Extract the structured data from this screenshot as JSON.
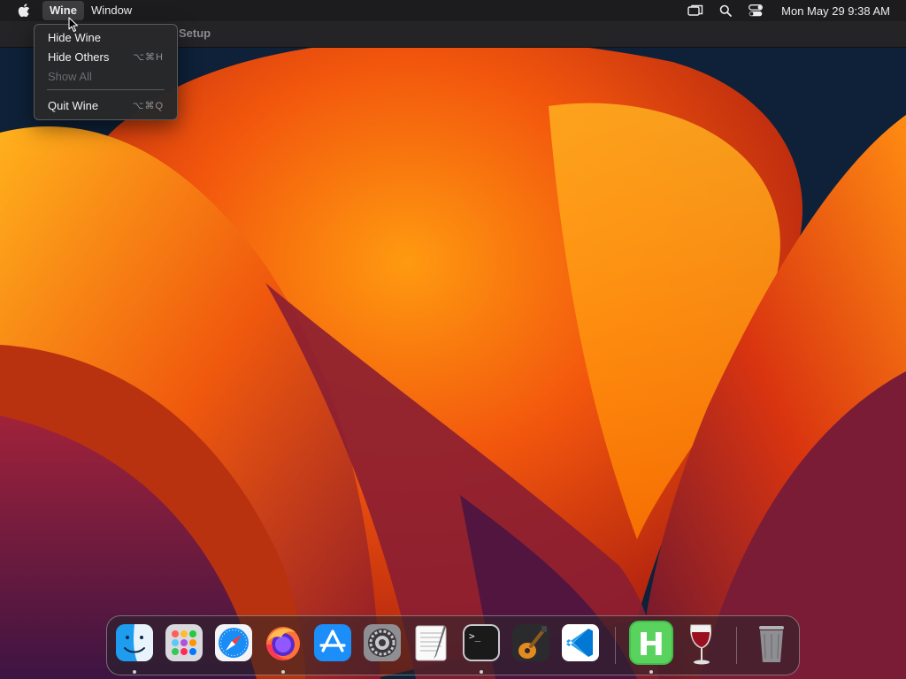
{
  "menubar": {
    "apple_icon": "apple-logo-icon",
    "items": [
      {
        "label": "Wine",
        "active": true
      },
      {
        "label": "Window",
        "active": false
      }
    ],
    "status_icons": [
      "screen-mirroring-icon",
      "spotlight-search-icon",
      "control-center-icon"
    ],
    "clock": "Mon May 29  9:38 AM"
  },
  "window": {
    "title": "Setup"
  },
  "app_menu": {
    "items": [
      {
        "label": "Hide Wine",
        "shortcut": "",
        "enabled": true
      },
      {
        "label": "Hide Others",
        "shortcut": "⌥⌘H",
        "enabled": true
      },
      {
        "label": "Show All",
        "shortcut": "",
        "enabled": false
      },
      {
        "label": "Quit Wine",
        "shortcut": "⌥⌘Q",
        "enabled": true
      }
    ]
  },
  "dock": {
    "apps": [
      {
        "icon": "finder-icon",
        "running": true
      },
      {
        "icon": "launchpad-icon",
        "running": false
      },
      {
        "icon": "safari-icon",
        "running": false
      },
      {
        "icon": "firefox-icon",
        "running": true
      },
      {
        "icon": "app-store-icon",
        "running": false
      },
      {
        "icon": "system-preferences-icon",
        "running": false
      },
      {
        "icon": "textedit-icon",
        "running": false
      },
      {
        "icon": "terminal-icon",
        "running": true
      },
      {
        "icon": "garageband-icon",
        "running": false
      },
      {
        "icon": "vscode-icon",
        "running": false
      },
      {
        "icon": "hex-fiend-icon",
        "running": true
      },
      {
        "icon": "wine-icon",
        "running": false
      },
      {
        "icon": "trash-icon",
        "running": false
      }
    ],
    "terminal_prompt": ">_",
    "hex_letter": "H"
  },
  "colors": {
    "menubar_bg": "#1c1c1e",
    "wallpaper_orange": "#ff7a00",
    "wallpaper_red": "#c9240e",
    "wallpaper_navy": "#0d2036"
  }
}
